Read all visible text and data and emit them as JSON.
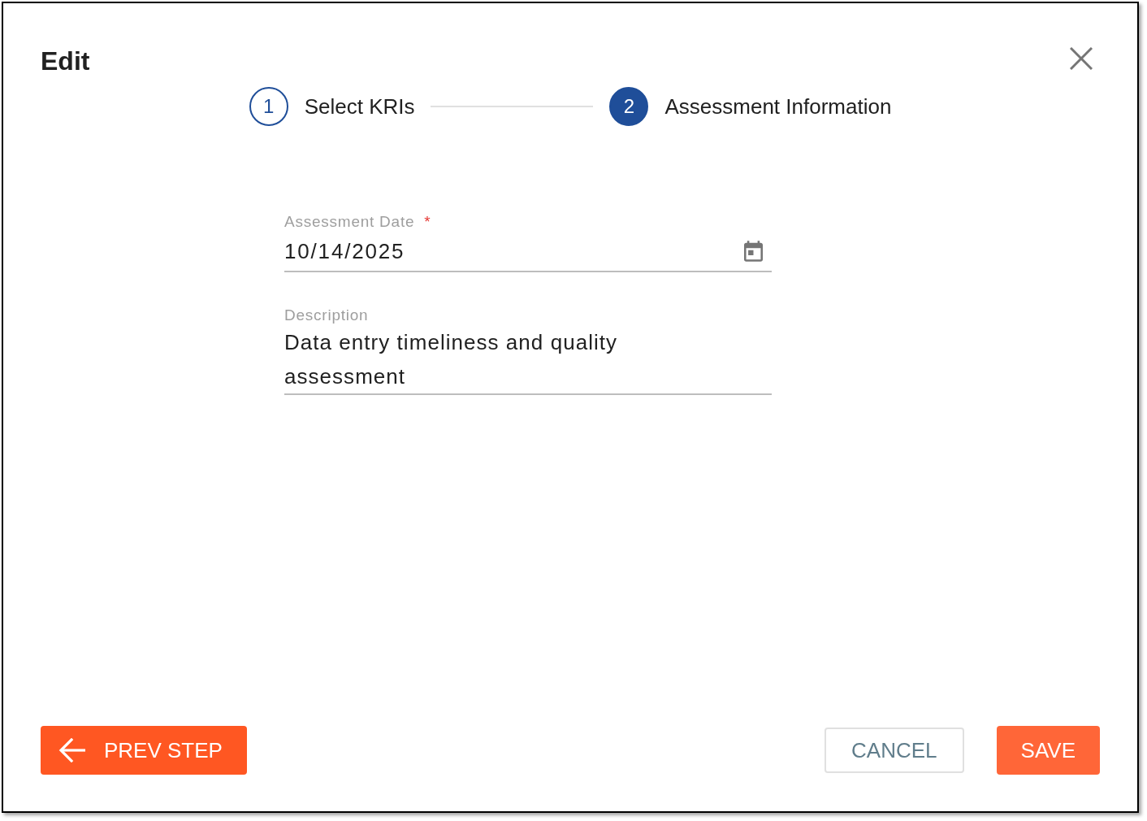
{
  "dialog": {
    "title": "Edit"
  },
  "stepper": {
    "steps": [
      {
        "number": "1",
        "label": "Select KRIs",
        "selected": false
      },
      {
        "number": "2",
        "label": "Assessment Information",
        "selected": true
      }
    ]
  },
  "form": {
    "fields": [
      {
        "kind": "date",
        "label": "Assessment Date",
        "required_marker": "*",
        "value": "10/14/2025"
      },
      {
        "kind": "textarea",
        "label": "Description",
        "value": "Data entry timeliness and quality assessment"
      }
    ]
  },
  "footer": {
    "buttons": [
      {
        "kind": "back",
        "label": "PREV STEP"
      },
      {
        "kind": "outlined",
        "label": "CANCEL"
      },
      {
        "kind": "primary",
        "label": "SAVE"
      }
    ]
  }
}
